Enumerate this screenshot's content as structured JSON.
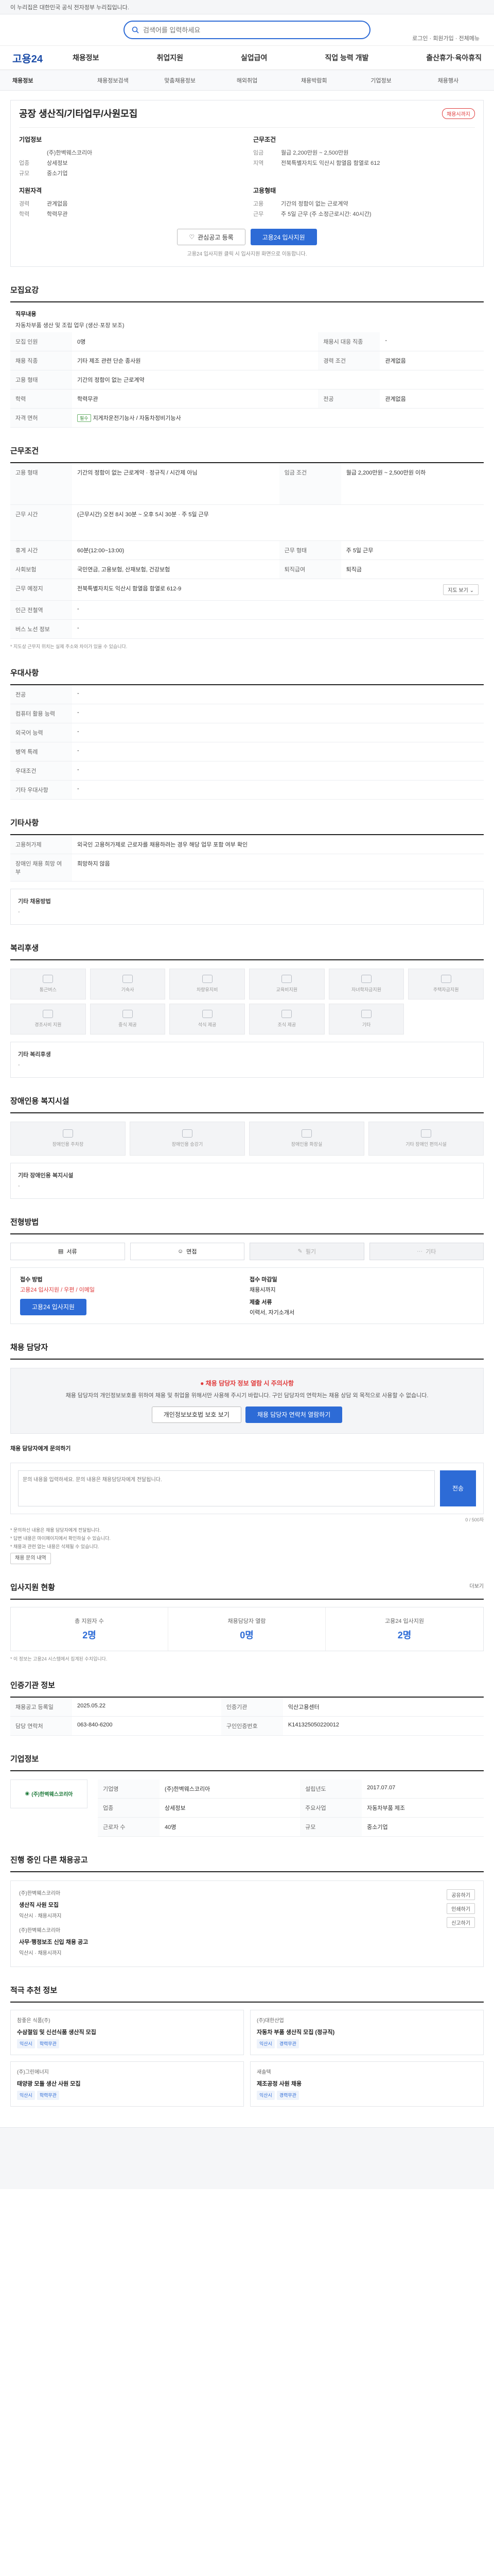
{
  "topbar": {
    "notice": "이 누리집은 대한민국 공식 전자정부 누리집입니다."
  },
  "header": {
    "logo": "고용24",
    "search_placeholder": "검색어를 입력하세요",
    "util_links": [
      "로그인",
      "회원가입",
      "전체메뉴"
    ],
    "menu": [
      "채용정보",
      "취업지원",
      "실업급여",
      "직업 능력 개발",
      "출산휴가·육아휴직"
    ]
  },
  "subnav": [
    "채용정보",
    "채용정보검색",
    "맞춤채용정보",
    "해외취업",
    "채용박람회",
    "기업정보",
    "채용행사"
  ],
  "job": {
    "title": "공장 생산직/기타업무/사원모집",
    "badge": "채용시까지",
    "company_label": "기업정보",
    "company_name": "(주)한벽웨스코리아",
    "company_rows": [
      {
        "k": "업종",
        "v": "상세정보"
      },
      {
        "k": "규모",
        "v": "중소기업"
      }
    ],
    "cond_label": "근무조건",
    "cond_rows": [
      {
        "k": "임금",
        "v": "월급 2,200만원 ~ 2,500만원"
      },
      {
        "k": "지역",
        "v": "전북특별자치도 익산시 함열읍 함열로 612"
      }
    ],
    "req_label": "지원자격",
    "req_rows": [
      {
        "k": "경력",
        "v": "관계없음"
      },
      {
        "k": "학력",
        "v": "학력무관"
      }
    ],
    "type_label": "고용형태",
    "type_rows": [
      {
        "k": "고용",
        "v": "기간의 정함이 없는 근로계약"
      },
      {
        "k": "근무",
        "v": "주 5일 근무 (주 소정근로시간: 40시간)"
      }
    ],
    "btn_scrap": "관심공고 등록",
    "btn_apply": "고용24 입사지원",
    "apply_note": "고용24 입사지원 클릭 시 입사지원 화면으로 이동합니다."
  },
  "sections": {
    "recruit_title": "모집요강",
    "duty_label": "직무내용",
    "duty_text": "자동차부품 생산 및 조립 업무 (생산·포장 보조)",
    "recruit_rows": [
      {
        "k": "모집 인원",
        "v": "0명",
        "k2": "채용시 대응 직종",
        "v2": "-"
      },
      {
        "k": "채용 직종",
        "v": "기타 제조 관련 단순 종사원",
        "k2": "경력 조건",
        "v2": "관계없음"
      },
      {
        "k": "고용 형태",
        "v": "기간의 정함이 없는 근로계약",
        "k2": "",
        "v2": ""
      },
      {
        "k": "학력",
        "v": "학력무관",
        "k2": "전공",
        "v2": "관계없음"
      },
      {
        "k": "자격 면허",
        "v": "지게차운전기능사 / 자동차정비기능사",
        "k2": "",
        "v2": ""
      }
    ],
    "condition_title": "근무조건",
    "cond_rows": [
      {
        "k": "고용 형태",
        "v": "기간의 정함이 없는 근로계약 · 정규직 / 시간제 아님",
        "k2": "임금 조건",
        "v2": "월급 2,200만원 ~ 2,500만원 이하"
      },
      {
        "k": "근무 시간",
        "v": "(근무시간) 오전 8시 30분 ~ 오후 5시 30분 · 주 5일 근무",
        "k2": "",
        "v2": ""
      },
      {
        "k": "휴게 시간",
        "v": "60분(12:00~13:00)",
        "k2": "근무 형태",
        "v2": "주 5일 근무"
      },
      {
        "k": "사회보험",
        "v": "국민연금, 고용보험, 산재보험, 건강보험",
        "k2": "퇴직급여",
        "v2": "퇴직금"
      },
      {
        "k": "근무 예정지",
        "v": "전북특별자치도 익산시 함열읍 함열로 612-9",
        "k2": "",
        "v2": ""
      },
      {
        "k": "인근 전철역",
        "v": "-",
        "k2": "",
        "v2": ""
      },
      {
        "k": "버스 노선 정보",
        "v": "-",
        "k2": "",
        "v2": ""
      }
    ],
    "cond_note": "* 지도상 근무지 위치는 실제 주소와 차이가 있을 수 있습니다.",
    "pref_title": "우대사항",
    "pref_rows": [
      {
        "k": "전공",
        "v": "-"
      },
      {
        "k": "컴퓨터 활용 능력",
        "v": "-"
      },
      {
        "k": "외국어 능력",
        "v": "-"
      },
      {
        "k": "병역 특례",
        "v": "-"
      },
      {
        "k": "우대조건",
        "v": "-"
      },
      {
        "k": "기타 우대사항",
        "v": "-"
      }
    ],
    "etc_title": "기타사항",
    "etc_rows": [
      {
        "k": "고용허가제",
        "v": "외국인 고용허가제로 근로자를 채용하려는 경우 해당 업무 포함 여부 확인"
      },
      {
        "k": "장애인 채용 희망 여부",
        "v": "희망하지 않음"
      }
    ],
    "etc_text_label": "기타 채용방법",
    "welfare_title": "복리후생",
    "welfare": [
      "통근버스",
      "기숙사",
      "차량유지비",
      "교육비지원",
      "자녀학자금지원",
      "주택자금지원",
      "경조사비 지원",
      "중식 제공",
      "석식 제공",
      "조식 제공",
      "기타"
    ],
    "welfare_text_label": "기타 복리후생",
    "disab_title": "장애인용 복지시설",
    "disab": [
      "장애인용 주차장",
      "장애인용 승강기",
      "장애인용 화장실",
      "기타 장애인 편의시설"
    ],
    "disab_text_label": "기타 장애인용 복지시설",
    "method_title": "전형방법",
    "steps": [
      "서류",
      "면접",
      "필기",
      "기타"
    ],
    "apply_method_label": "접수 방법",
    "apply_method": "고용24 입사지원 / 우편 / 이메일",
    "apply_deadline_label": "접수 마감일",
    "apply_deadline": "채용시까지",
    "apply_doc_label": "제출 서류",
    "apply_doc": "이력서, 자기소개서",
    "apply_btn": "고용24 입사지원",
    "contact_title": "채용 담당자",
    "warn_title": "채용 담당자 정보 열람 시 주의사항",
    "warn_text": "채용 담당자의 개인정보보호를 위하여 채용 및 취업을 위해서만 사용해 주시기 바랍니다. 구인 담당자의 연락처는 채용 상담 외 목적으로 사용할 수 없습니다.",
    "warn_btn1": "개인정보보호법 보호 보기",
    "warn_btn2": "채용 담당자 연락처 열람하기",
    "qa_label": "채용 담당자에게 문의하기",
    "qa_placeholder": "문의 내용을 입력하세요. 문의 내용은 채용담당자에게 전달됩니다.",
    "qa_send": "전송",
    "qa_count": "0 / 500자",
    "qa_notes": [
      "* 문의하신 내용은 채용 담당자에게 전달됩니다.",
      "* 답변 내용은 마이페이지에서 확인하실 수 있습니다.",
      "* 채용과 관련 없는 내용은 삭제될 수 있습니다."
    ],
    "qa_history_btn": "채용 문의 내역",
    "stats_title": "입사지원 현황",
    "stats_more": "더보기",
    "stats": [
      {
        "label": "총 지원자 수",
        "value": "2명"
      },
      {
        "label": "채용담당자 열람",
        "value": "0명"
      },
      {
        "label": "고용24 입사지원",
        "value": "2명"
      }
    ],
    "stats_note": "* 이 정보는 고용24 시스템에서 집계된 수치입니다.",
    "info_title": "인증기관 정보",
    "info_rows": [
      {
        "k": "채용공고 등록일",
        "v": "2025.05.22",
        "k2": "인증기관",
        "v2": "익산고용센터"
      },
      {
        "k": "담당 연락처",
        "v": "063-840-6200",
        "k2": "구인인증번호",
        "v2": "K141325050220012"
      }
    ],
    "corp_title": "기업정보",
    "corp_name": "(주)한벽웨스코리아",
    "corp_rows": [
      {
        "k": "기업명",
        "v": "(주)한벽웨스코리아",
        "k2": "설립년도",
        "v2": "2017.07.07"
      },
      {
        "k": "업종",
        "v": "상세정보",
        "k2": "주요사업",
        "v2": "자동차부품 제조"
      },
      {
        "k": "근로자 수",
        "v": "40명",
        "k2": "규모",
        "v2": "중소기업"
      }
    ],
    "other_title": "진행 중인 다른 채용공고",
    "other_items": [
      {
        "co": "(주)한벽웨스코리아",
        "tt": "생산직 사원 모집",
        "info": "익산시 · 채용시까지"
      },
      {
        "co": "(주)한벽웨스코리아",
        "tt": "사무·행정보조 신입 채용 공고",
        "info": "익산시 · 채용시까지"
      }
    ],
    "rec_title": "적극 추천 정보",
    "recs": [
      {
        "co": "참좋은 식품(주)",
        "tt": "수삼절임 및 신선식품 생산직 모집",
        "tags": [
          "익산시",
          "학력무관"
        ]
      },
      {
        "co": "(주)대한산업",
        "tt": "자동차 부품 생산직 모집 (정규직)",
        "tags": [
          "익산시",
          "경력무관"
        ]
      },
      {
        "co": "(주)그린에너지",
        "tt": "태양광 모듈 생산 사원 모집",
        "tags": [
          "익산시",
          "학력무관"
        ]
      },
      {
        "co": "새솔텍",
        "tt": "제조공정 사원 채용",
        "tags": [
          "익산시",
          "경력무관"
        ]
      }
    ]
  }
}
